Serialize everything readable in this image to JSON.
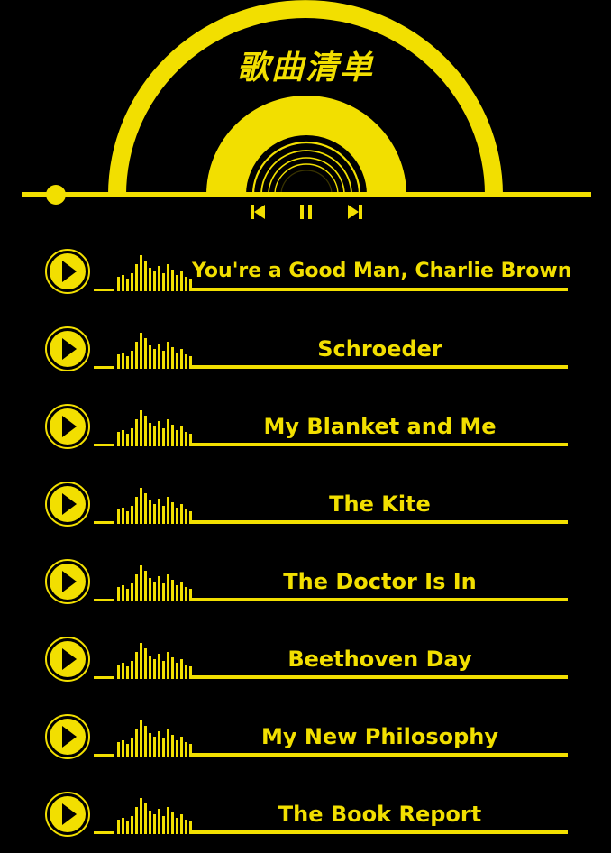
{
  "header": {
    "title": "歌曲清单"
  },
  "player": {
    "progress": 0.06,
    "controls": {
      "previous_icon": "skip-previous-icon",
      "pause_icon": "pause-icon",
      "next_icon": "skip-next-icon"
    }
  },
  "playlist": {
    "tracks": [
      {
        "title": "You're a Good Man, Charlie Brown",
        "icon": "play-icon"
      },
      {
        "title": "Schroeder",
        "icon": "play-icon"
      },
      {
        "title": "My Blanket and Me",
        "icon": "play-icon"
      },
      {
        "title": "The Kite",
        "icon": "play-icon"
      },
      {
        "title": "The Doctor Is In",
        "icon": "play-icon"
      },
      {
        "title": "Beethoven Day",
        "icon": "play-icon"
      },
      {
        "title": "My New Philosophy",
        "icon": "play-icon"
      },
      {
        "title": "The Book Report",
        "icon": "play-icon"
      }
    ]
  },
  "theme": {
    "accent": "#f2df00",
    "background": "#000000"
  }
}
